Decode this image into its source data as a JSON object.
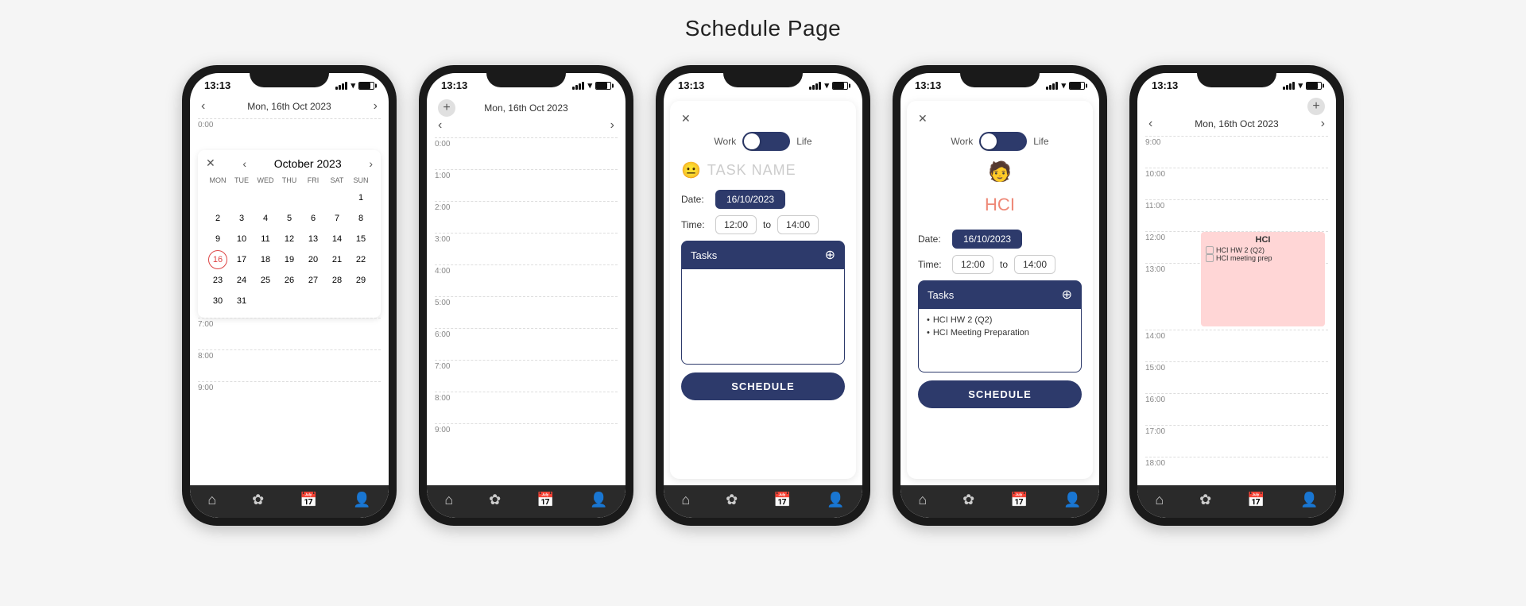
{
  "page": {
    "title": "Schedule Page"
  },
  "phones": [
    {
      "id": "phone1",
      "status_time": "13:13",
      "type": "calendar",
      "nav_date": "Mon, 16th Oct 2023",
      "calendar": {
        "month": "October 2023",
        "weekdays": [
          "MON",
          "TUE",
          "WED",
          "THU",
          "FRI",
          "SAT",
          "SUN"
        ],
        "weeks": [
          [
            null,
            null,
            null,
            null,
            null,
            null,
            1
          ],
          [
            2,
            3,
            4,
            5,
            6,
            7,
            8
          ],
          [
            9,
            10,
            11,
            12,
            13,
            14,
            15
          ],
          [
            16,
            17,
            18,
            19,
            20,
            21,
            22
          ],
          [
            23,
            24,
            25,
            26,
            27,
            28,
            29
          ],
          [
            30,
            31,
            null,
            null,
            null,
            null,
            null
          ]
        ],
        "today": 16
      },
      "times": [
        "0:00",
        "7:00",
        "8:00",
        "9:00"
      ]
    },
    {
      "id": "phone2",
      "status_time": "13:13",
      "type": "schedule_empty",
      "nav_date": "Mon, 16th Oct 2023",
      "times": [
        "0:00",
        "1:00",
        "2:00",
        "3:00",
        "4:00",
        "5:00",
        "6:00",
        "7:00",
        "8:00",
        "9:00"
      ]
    },
    {
      "id": "phone3",
      "status_time": "13:13",
      "type": "add_task_empty",
      "toggle_left": "Work",
      "toggle_right": "Life",
      "task_name_placeholder": "TASK NAME",
      "date_label": "Date:",
      "date_value": "16/10/2023",
      "time_label": "Time:",
      "time_from": "12:00",
      "time_to": "14:00",
      "tasks_header": "Tasks",
      "schedule_btn": "SCHEDULE"
    },
    {
      "id": "phone4",
      "status_time": "13:13",
      "type": "add_task_filled",
      "toggle_left": "Work",
      "toggle_right": "Life",
      "task_name": "HCI",
      "date_label": "Date:",
      "date_value": "16/10/2023",
      "time_label": "Time:",
      "time_from": "12:00",
      "time_to": "14:00",
      "tasks_header": "Tasks",
      "tasks": [
        "HCI HW 2 (Q2)",
        "HCI Meeting Preparation"
      ],
      "schedule_btn": "SCHEDULE"
    },
    {
      "id": "phone5",
      "status_time": "13:13",
      "type": "schedule_event",
      "nav_date": "Mon, 16th Oct 2023",
      "event": {
        "title": "HCI",
        "tasks": [
          "HCI HW 2 (Q2)",
          "HCI meeting prep"
        ]
      },
      "times": [
        "9:00",
        "10:00",
        "11:00",
        "12:00",
        "13:00",
        "14:00",
        "15:00",
        "16:00",
        "17:00",
        "18:00"
      ]
    }
  ],
  "bottom_nav": {
    "icons": [
      "🏠",
      "🐾",
      "📅",
      "👤"
    ]
  }
}
